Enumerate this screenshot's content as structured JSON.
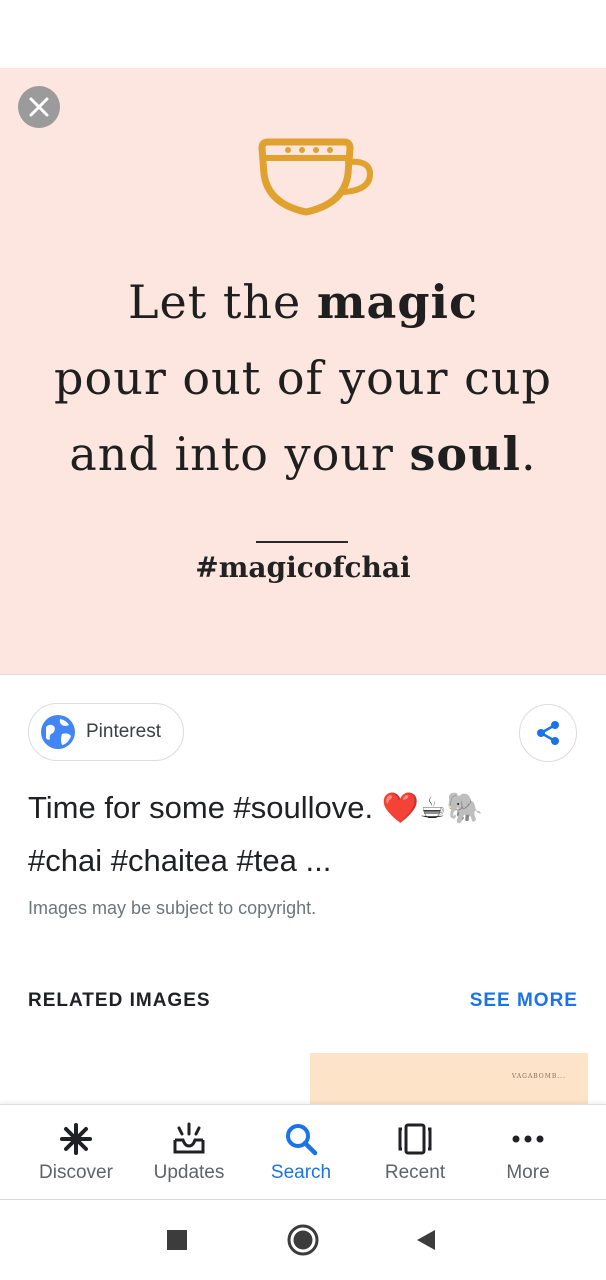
{
  "hero": {
    "quote_line1_normal": "Let the ",
    "quote_line1_bold": "magic",
    "quote_line2": "pour out of your cup",
    "quote_line3_normal": "and into your ",
    "quote_line3_bold": "soul",
    "quote_line3_end": ".",
    "hashtag": "#magicofchai",
    "background_color": "#fde6df"
  },
  "source": {
    "label": "Pinterest",
    "icon": "globe-icon"
  },
  "title": {
    "line1_text": "Time for some #soullove. ",
    "heart": "❤️",
    "cup": "☕",
    "elephant": "🐘",
    "line2_text": "#chai #chaitea #tea ..."
  },
  "copyright": "Images may be subject to copyright.",
  "related": {
    "heading": "RELATED IMAGES",
    "see_more": "SEE MORE",
    "thumb_text": "VAGABOMB..."
  },
  "nav": {
    "items": [
      {
        "label": "Discover",
        "icon": "asterisk-icon",
        "active": false
      },
      {
        "label": "Updates",
        "icon": "updates-icon",
        "active": false
      },
      {
        "label": "Search",
        "icon": "search-icon",
        "active": true
      },
      {
        "label": "Recent",
        "icon": "recent-icon",
        "active": false
      },
      {
        "label": "More",
        "icon": "more-dots-icon",
        "active": false
      }
    ],
    "active_color": "#1a73e8"
  }
}
